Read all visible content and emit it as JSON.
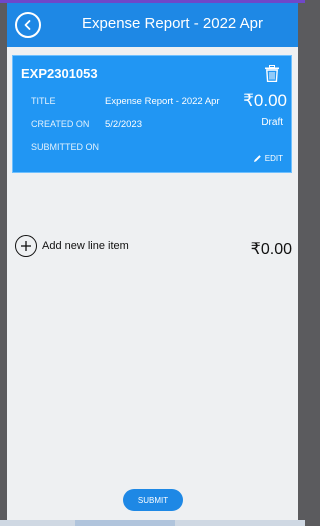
{
  "header": {
    "title": "Expense Report - 2022 Apr",
    "back_icon": "chevron-left-icon"
  },
  "report": {
    "id": "EXP2301053",
    "title_label": "TITLE",
    "title_value": "Expense Report - 2022 Apr",
    "created_label": "CREATED ON",
    "created_value": "5/2/2023",
    "submitted_label": "SUBMITTED ON",
    "submitted_value": "",
    "amount": "₹0.00",
    "status": "Draft",
    "edit_label": "EDIT"
  },
  "line_items": {
    "add_label": "Add new line item",
    "total": "₹0.00"
  },
  "footer": {
    "submit_label": "SUBMIT"
  },
  "colors": {
    "accent": "#1e88e5",
    "card": "#2196f3",
    "background": "#eef0f2"
  }
}
